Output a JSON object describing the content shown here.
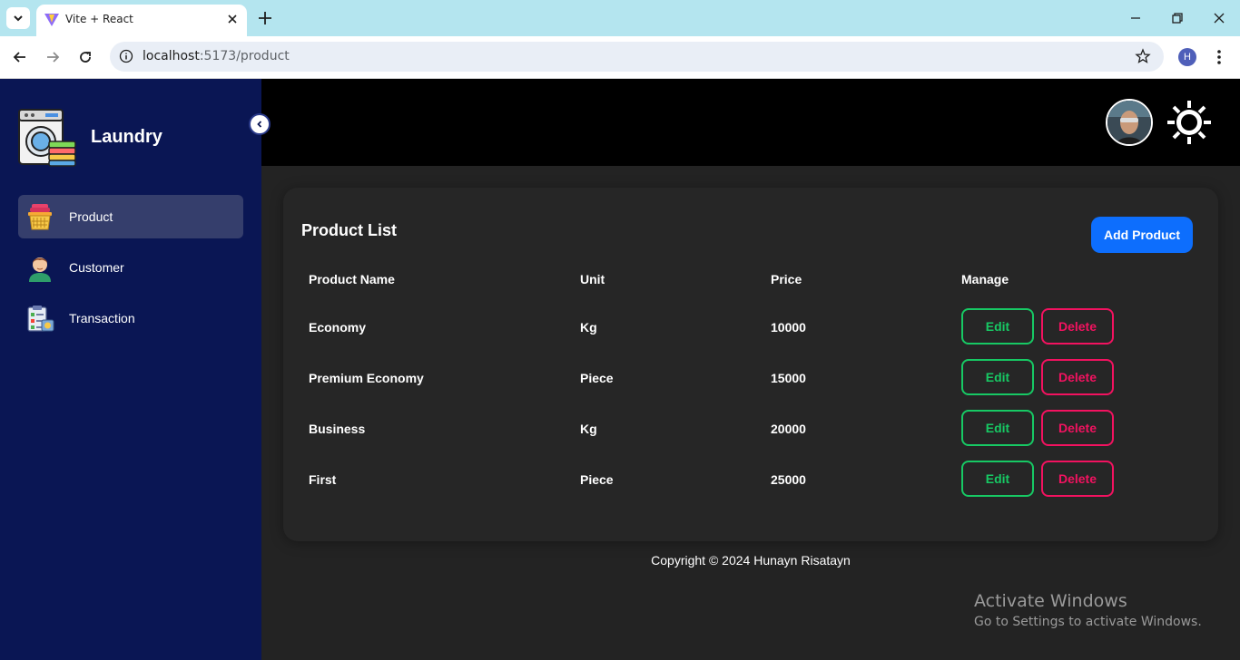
{
  "browser": {
    "tab_title": "Vite + React",
    "url_host": "localhost",
    "url_path": ":5173/product",
    "profile_initial": "H"
  },
  "sidebar": {
    "brand": "Laundry",
    "items": [
      {
        "label": "Product",
        "icon": "laundry-basket-icon",
        "active": true
      },
      {
        "label": "Customer",
        "icon": "customer-avatar-icon",
        "active": false
      },
      {
        "label": "Transaction",
        "icon": "transaction-clipboard-icon",
        "active": false
      }
    ]
  },
  "main": {
    "title": "Product List",
    "add_button": "Add Product",
    "columns": [
      "Product Name",
      "Unit",
      "Price",
      "Manage"
    ],
    "rows": [
      {
        "name": "Economy",
        "unit": "Kg",
        "price": "10000"
      },
      {
        "name": "Premium Economy",
        "unit": "Piece",
        "price": "15000"
      },
      {
        "name": "Business",
        "unit": "Kg",
        "price": "20000"
      },
      {
        "name": "First",
        "unit": "Piece",
        "price": "25000"
      }
    ],
    "edit_label": "Edit",
    "delete_label": "Delete"
  },
  "footer": {
    "copyright": "Copyright © 2024 Hunayn Risatayn"
  },
  "watermark": {
    "line1": "Activate Windows",
    "line2": "Go to Settings to activate Windows."
  },
  "colors": {
    "sidebar_bg": "#0a1654",
    "accent_blue": "#0d6efd",
    "edit_green": "#17c964",
    "delete_red": "#f31260"
  }
}
